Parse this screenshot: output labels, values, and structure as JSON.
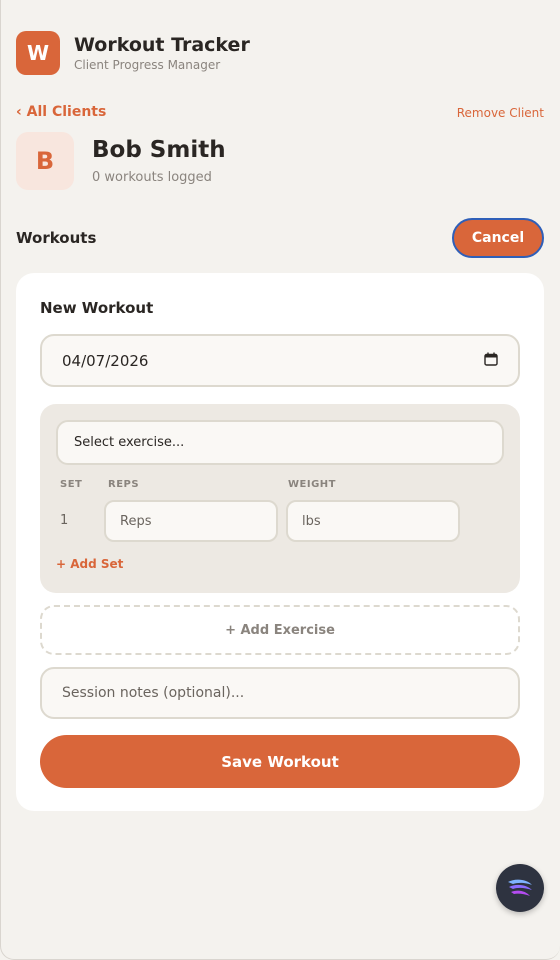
{
  "app": {
    "logo_letter": "W",
    "title": "Workout Tracker",
    "subtitle": "Client Progress Manager"
  },
  "client": {
    "back_label": "‹ All Clients",
    "remove_label": "Remove Client",
    "avatar_letter": "B",
    "name": "Bob Smith",
    "meta": "0 workouts logged"
  },
  "section": {
    "title": "Workouts",
    "cancel_label": "Cancel"
  },
  "form": {
    "title": "New Workout",
    "date_value": "04/07/2026",
    "exercise_placeholder": "Select exercise...",
    "col_set": "SET",
    "col_reps": "REPS",
    "col_weight": "WEIGHT",
    "set_number": "1",
    "reps_placeholder": "Reps",
    "weight_placeholder": "lbs",
    "add_set_label": "+ Add Set",
    "add_exercise_label": "+ Add Exercise",
    "notes_placeholder": "Session notes (optional)...",
    "save_label": "Save Workout"
  },
  "colors": {
    "accent": "#d9663a",
    "background": "#f4f2ee",
    "card": "#ffffff"
  },
  "icons": {
    "calendar": "calendar-icon",
    "assistant": "assistant-icon"
  }
}
